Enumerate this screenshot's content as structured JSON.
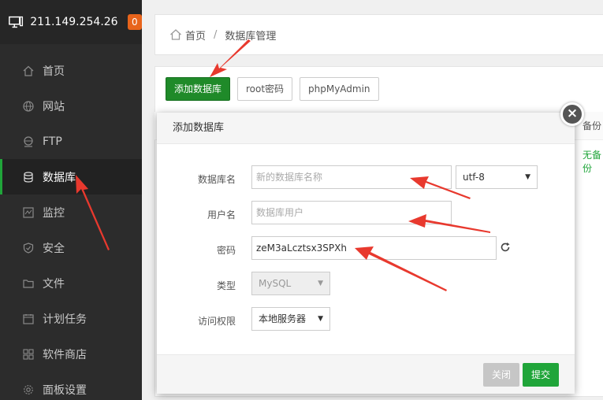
{
  "sidebar": {
    "server_ip": "211.149.254.26",
    "badge_count": "0",
    "items": [
      {
        "label": "首页",
        "icon": "home-icon"
      },
      {
        "label": "网站",
        "icon": "globe-icon"
      },
      {
        "label": "FTP",
        "icon": "ftp-icon"
      },
      {
        "label": "数据库",
        "icon": "database-icon"
      },
      {
        "label": "监控",
        "icon": "monitor-icon"
      },
      {
        "label": "安全",
        "icon": "shield-icon"
      },
      {
        "label": "文件",
        "icon": "folder-icon"
      },
      {
        "label": "计划任务",
        "icon": "calendar-icon"
      },
      {
        "label": "软件商店",
        "icon": "grid-icon"
      },
      {
        "label": "面板设置",
        "icon": "gear-icon"
      }
    ],
    "active_index": 3
  },
  "breadcrumb": {
    "home": "首页",
    "separator": "/",
    "current": "数据库管理"
  },
  "toolbar": {
    "add_db": "添加数据库",
    "root_pwd": "root密码",
    "phpmyadmin": "phpMyAdmin"
  },
  "table": {
    "backup_header": "备份",
    "backup_value": "无备份"
  },
  "dialog": {
    "title": "添加数据库",
    "db_name_label": "数据库名",
    "db_name_placeholder": "新的数据库名称",
    "charset": "utf-8",
    "user_label": "用户名",
    "user_placeholder": "数据库用户",
    "password_label": "密码",
    "password_value": "zeM3aLcztsx3SPXh",
    "type_label": "类型",
    "type_value": "MySQL",
    "access_label": "访问权限",
    "access_value": "本地服务器",
    "close_btn": "关闭",
    "submit_btn": "提交"
  },
  "colors": {
    "accent_green": "#20a53a",
    "badge_orange": "#e8641b",
    "arrow_red": "#e8392e"
  }
}
